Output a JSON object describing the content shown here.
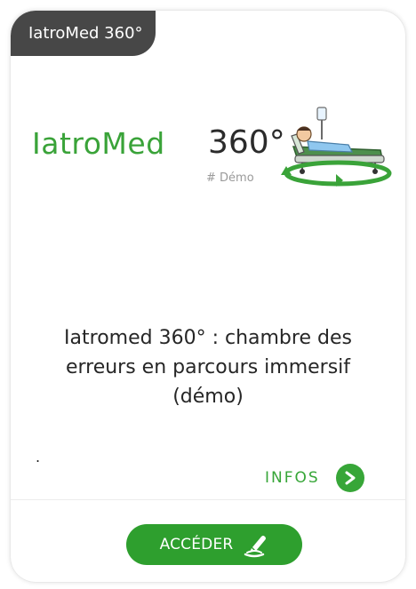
{
  "card": {
    "badge": "IatroMed 360°",
    "logo": {
      "brand": "IatroMed",
      "number": "360°",
      "tag": "# Démo"
    },
    "title": "Iatromed 360° : chambre des erreurs en parcours immersif (démo)",
    "dot": ".",
    "infos_label": "INFOS",
    "access_label": "ACCÉDER"
  },
  "colors": {
    "accent_green": "#37a638",
    "badge_bg": "#474747"
  },
  "icons": {
    "infos": "chevron-right-icon",
    "access": "edit-pen-icon",
    "logo": "hospital-bed-360-icon"
  }
}
